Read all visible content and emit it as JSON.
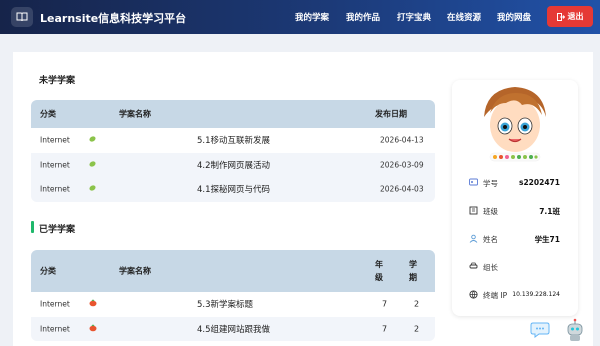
{
  "header": {
    "brand": "Learnsite信息科技学习平台",
    "nav": [
      "我的学案",
      "我的作品",
      "打字宝典",
      "在线资源",
      "我的网盘"
    ],
    "logout": "退出"
  },
  "unlearned": {
    "title": "未学学案",
    "columns": [
      "分类",
      "学案名称",
      "发布日期"
    ],
    "rows": [
      {
        "category": "Internet",
        "name": "5.1移动互联新发展",
        "date": "2026-04-13"
      },
      {
        "category": "Internet",
        "name": "4.2制作网页展活动",
        "date": "2026-03-09"
      },
      {
        "category": "Internet",
        "name": "4.1探秘网页与代码",
        "date": "2026-04-03"
      }
    ]
  },
  "learned": {
    "title": "已学学案",
    "columns": [
      "分类",
      "学案名称",
      "年级",
      "学期"
    ],
    "rows": [
      {
        "category": "Internet",
        "name": "5.3新学案标题",
        "grade": "7",
        "term": "2"
      },
      {
        "category": "Internet",
        "name": "4.5组建网站跟我做",
        "grade": "7",
        "term": "2"
      }
    ]
  },
  "profile": {
    "items": [
      {
        "label": "学号",
        "value": "s2202471",
        "icon": "id-card-icon"
      },
      {
        "label": "班级",
        "value": "7.1班",
        "icon": "building-icon"
      },
      {
        "label": "姓名",
        "value": "学生71",
        "icon": "user-icon"
      },
      {
        "label": "组长",
        "value": "",
        "icon": "car-icon"
      },
      {
        "label": "终端 IP",
        "value": "10.139.228.124",
        "icon": "globe-icon"
      }
    ]
  },
  "colors": {
    "nav_bg": "#1c3a78",
    "logout": "#e53935",
    "table_header": "#c7d8e6",
    "section_accent": "#1fb86b"
  }
}
